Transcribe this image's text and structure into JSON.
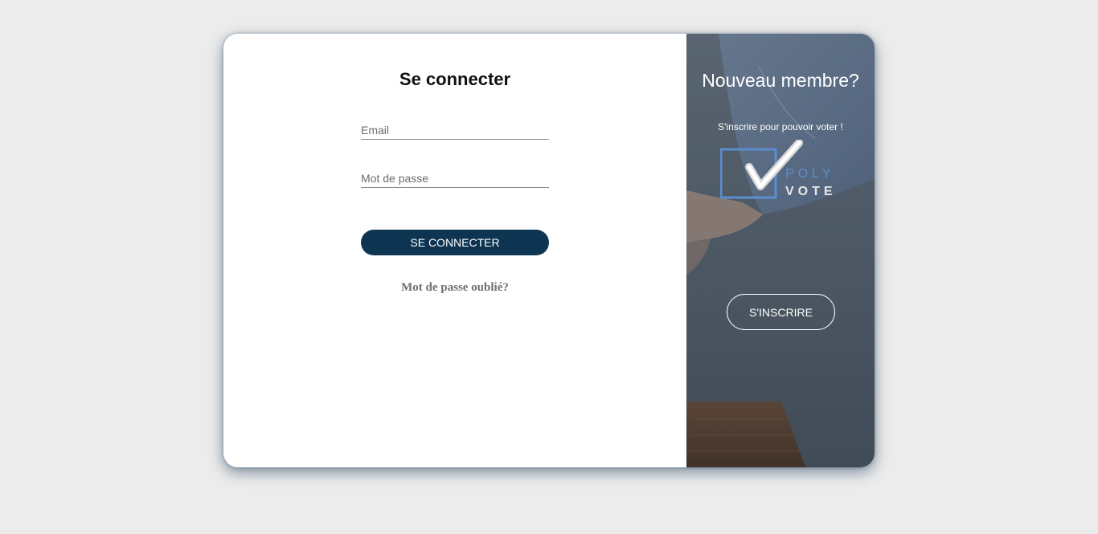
{
  "login": {
    "title": "Se connecter",
    "email_placeholder": "Email",
    "password_placeholder": "Mot de passe",
    "submit_label": "SE CONNECTER",
    "forgot_password": "Mot de passe oublié?"
  },
  "signup": {
    "title": "Nouveau membre?",
    "subtitle": "S'inscrire pour pouvoir voter !",
    "button_label": "S'INSCRIRE",
    "logo": {
      "word_top": "POLY",
      "word_bottom": "VOTE",
      "icon": "checkmark-ballot-icon"
    }
  },
  "colors": {
    "page_background": "#ececec",
    "primary_button": "#0d3552",
    "logo_blue": "#5a8fcf"
  }
}
